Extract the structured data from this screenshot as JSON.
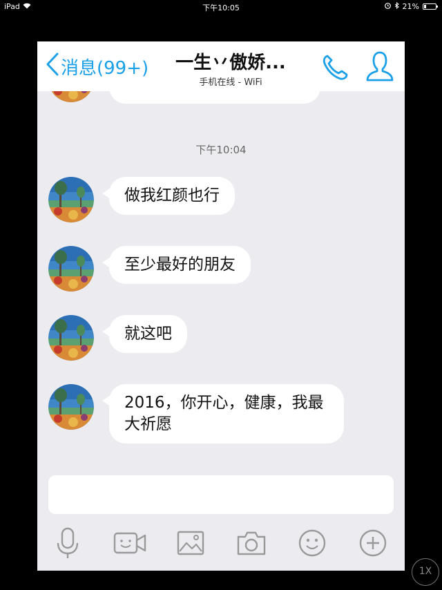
{
  "status_bar": {
    "device": "iPad",
    "time": "下午10:05",
    "battery": "21%",
    "battery_level": 0.21
  },
  "nav": {
    "back_label": "消息(99+)",
    "title": "一生丷傲娇...",
    "subtitle": "手机在线 - WiFi"
  },
  "chat": {
    "timestamp": "下午10:04",
    "messages": [
      {
        "text": "做我红颜也行"
      },
      {
        "text": "至少最好的朋友"
      },
      {
        "text": "就这吧"
      },
      {
        "text": "2016，你开心，健康，我最大祈愿"
      }
    ]
  },
  "input": {
    "value": ""
  },
  "toolbar": {
    "icons": [
      "microphone-icon",
      "video-icon",
      "image-icon",
      "camera-icon",
      "emoji-icon",
      "plus-icon"
    ]
  },
  "playback": {
    "speed": "1X"
  },
  "colors": {
    "accent": "#1aa0e8",
    "background": "#ebebf0",
    "bubble": "#ffffff"
  }
}
